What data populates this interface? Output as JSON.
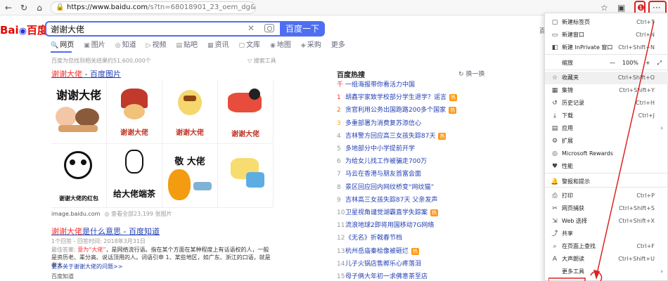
{
  "browser": {
    "url_host": "https://www.baidu.com",
    "url_rest": "/s?tn=68018901_23_oem_dg&ie=utf-8&wd=谢",
    "icons": [
      "back-icon",
      "refresh-icon",
      "home-icon",
      "lock-icon",
      "favorites-icon",
      "collections-icon",
      "profile-icon",
      "more-icon"
    ]
  },
  "search": {
    "query": "谢谢大佬",
    "button": "百度一下",
    "clear": "✕"
  },
  "logo": {
    "bai": "Bai",
    "du": "百度"
  },
  "tabs": [
    {
      "label": "网页",
      "icon": "🔍"
    },
    {
      "label": "图片",
      "icon": "▣"
    },
    {
      "label": "知道",
      "icon": "◎"
    },
    {
      "label": "视频",
      "icon": "▷"
    },
    {
      "label": "贴吧",
      "icon": "▤"
    },
    {
      "label": "资讯",
      "icon": "▦"
    },
    {
      "label": "文库",
      "icon": "▢"
    },
    {
      "label": "地图",
      "icon": "◉"
    },
    {
      "label": "采购",
      "icon": "◈"
    },
    {
      "label": "更多",
      "icon": ""
    }
  ],
  "meta": {
    "count": "百度为您找到相关结果约51,600,000个",
    "tools": "搜索工具"
  },
  "result1": {
    "title_em": "谢谢大佬",
    "title_rest": " - 百度图片",
    "captions": [
      "谢谢大佬",
      "谢谢大佬",
      "谢谢大佬",
      "谢谢大佬",
      "谢谢大佬的红包",
      "给大佬端茶",
      "敬 大佬",
      ""
    ],
    "source": "image.baidu.com",
    "more": "查看全部23,199 张图片"
  },
  "result2": {
    "title_em": "谢谢大佬",
    "title_rest": "是什么意思 - 百度知道",
    "sub": "1个回答 - 回答时间: 2018年3月31日",
    "abstract_label": "最佳答案: ",
    "abstract_em": "意为“大佬”",
    "abstract_rest": "，是网络流行语。指在某个方面在某种程度上有话语权的人，一般是资历老、辈分高、说话顶用的人。词语引申 1、某些地区，如广东、浙江的口语，就是老大...",
    "more": "更多关于谢谢大佬的问题>>",
    "foot": "百度知道"
  },
  "hot": {
    "title": "百度热搜",
    "change": "换一换",
    "items": [
      {
        "rank": "千",
        "text": "一组海报带你看活力中国",
        "tag": ""
      },
      {
        "rank": "1",
        "text": "胡鑫宇家致学校部分学生退学？谣言",
        "tag": "热"
      },
      {
        "rank": "2",
        "text": "贪官利用公务出国跑路200多个国家",
        "tag": "热"
      },
      {
        "rank": "3",
        "text": "多重部署为消费复苏添信心",
        "tag": ""
      },
      {
        "rank": "4",
        "text": "吉林警方回应高三女孩失踪87天",
        "tag": "热"
      },
      {
        "rank": "5",
        "text": "多地部分中小学提前开学",
        "tag": ""
      },
      {
        "rank": "6",
        "text": "为给女儿找工作被骗走700万",
        "tag": ""
      },
      {
        "rank": "7",
        "text": "马云在香港与朋友首富会面",
        "tag": ""
      },
      {
        "rank": "8",
        "text": "景区回应回内网纹桥变“网纹猫”",
        "tag": ""
      },
      {
        "rank": "9",
        "text": "吉林高三女孩失踪87天 父亲发声",
        "tag": ""
      },
      {
        "rank": "10",
        "text": "卫星视角谴觉湖霸直学失踪案",
        "tag": "热"
      },
      {
        "rank": "11",
        "text": "流浪地球2即将用国移动7G网络",
        "tag": ""
      },
      {
        "rank": "12",
        "text": "《无名》折戟春节档",
        "tag": ""
      },
      {
        "rank": "13",
        "text": "杭州岳庙秦桧像被砸烂",
        "tag": "热"
      },
      {
        "rank": "14",
        "text": "儿子火锅店售孵乐心疼落泪",
        "tag": ""
      },
      {
        "rank": "15",
        "text": "母子俩大年初一求佛意茶至店",
        "tag": ""
      }
    ]
  },
  "menu": {
    "items": [
      {
        "icon": "▢",
        "label": "新建标签页",
        "shortcut": "Ctrl+T",
        "arrow": ""
      },
      {
        "icon": "▭",
        "label": "新建窗口",
        "shortcut": "Ctrl+N",
        "arrow": ""
      },
      {
        "icon": "◧",
        "label": "新建 InPrivate 窗口",
        "shortcut": "Ctrl+Shift+N",
        "arrow": ""
      },
      {
        "icon": "",
        "label": "缩放",
        "shortcut": "",
        "arrow": ""
      },
      {
        "icon": "☆",
        "label": "收藏夹",
        "shortcut": "Ctrl+Shift+O",
        "arrow": ""
      },
      {
        "icon": "▦",
        "label": "集锦",
        "shortcut": "Ctrl+Shift+Y",
        "arrow": ""
      },
      {
        "icon": "↺",
        "label": "历史记录",
        "shortcut": "Ctrl+H",
        "arrow": ""
      },
      {
        "icon": "⤓",
        "label": "下载",
        "shortcut": "Ctrl+J",
        "arrow": ""
      },
      {
        "icon": "▤",
        "label": "应用",
        "shortcut": "",
        "arrow": "›"
      },
      {
        "icon": "⚙",
        "label": "扩展",
        "shortcut": "",
        "arrow": ""
      },
      {
        "icon": "◎",
        "label": "Microsoft Rewards",
        "shortcut": "",
        "arrow": ""
      },
      {
        "icon": "♥",
        "label": "性能",
        "shortcut": "",
        "arrow": ""
      },
      {
        "icon": "🔔",
        "label": "警报和提示",
        "shortcut": "",
        "arrow": ""
      },
      {
        "icon": "⎙",
        "label": "打印",
        "shortcut": "Ctrl+P",
        "arrow": ""
      },
      {
        "icon": "✂",
        "label": "网页捕获",
        "shortcut": "Ctrl+Shift+S",
        "arrow": ""
      },
      {
        "icon": "⇲",
        "label": "Web 选择",
        "shortcut": "Ctrl+Shift+X",
        "arrow": ""
      },
      {
        "icon": "⤴",
        "label": "共享",
        "shortcut": "",
        "arrow": ""
      },
      {
        "icon": "⌕",
        "label": "在页面上查找",
        "shortcut": "Ctrl+F",
        "arrow": ""
      },
      {
        "icon": "A",
        "label": "大声朗读",
        "shortcut": "Ctrl+Shift+U",
        "arrow": ""
      },
      {
        "icon": "",
        "label": "更多工具",
        "shortcut": "",
        "arrow": "›"
      }
    ],
    "zoom": {
      "minus": "—",
      "value": "100%",
      "plus": "+",
      "full": "⤢"
    }
  },
  "side_char": "百",
  "colors": {
    "accent": "#4e6ef2",
    "em": "#f73131",
    "link": "#2440b3",
    "annotation": "#d22222"
  }
}
